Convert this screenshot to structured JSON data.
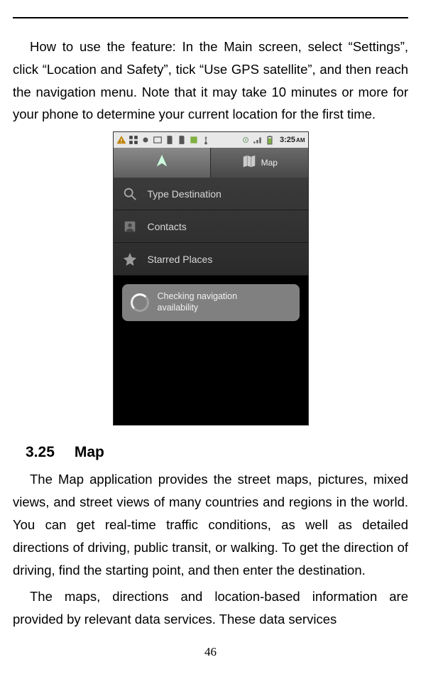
{
  "body": {
    "para1": "How to use the feature: In the Main screen, select “Settings”, click “Location and Safety”, tick “Use GPS satellite”, and then reach the navigation menu. Note that it may take 10 minutes or more for your phone to determine your current location for the first time.",
    "heading_num": "3.25",
    "heading_text": "Map",
    "para2": "The Map application provides the street maps, pictures, mixed views, and street views of many countries and regions in the world. You can get real-time traffic conditions, as well as detailed directions of driving, public transit, or walking. To get the direction of driving, find the starting point, and then enter the destination.",
    "para3": "The maps, directions and location-based information are provided by relevant data services. These data services",
    "page_number": "46"
  },
  "phone": {
    "status": {
      "time": "3:25",
      "ampm": "AM"
    },
    "tabs": {
      "nav_icon": "navigation-arrow",
      "map_label": "Map"
    },
    "rows": {
      "type_destination": "Type Destination",
      "contacts": "Contacts",
      "starred": "Starred Places"
    },
    "toast": {
      "line1": "Checking navigation",
      "line2": "availability"
    }
  }
}
